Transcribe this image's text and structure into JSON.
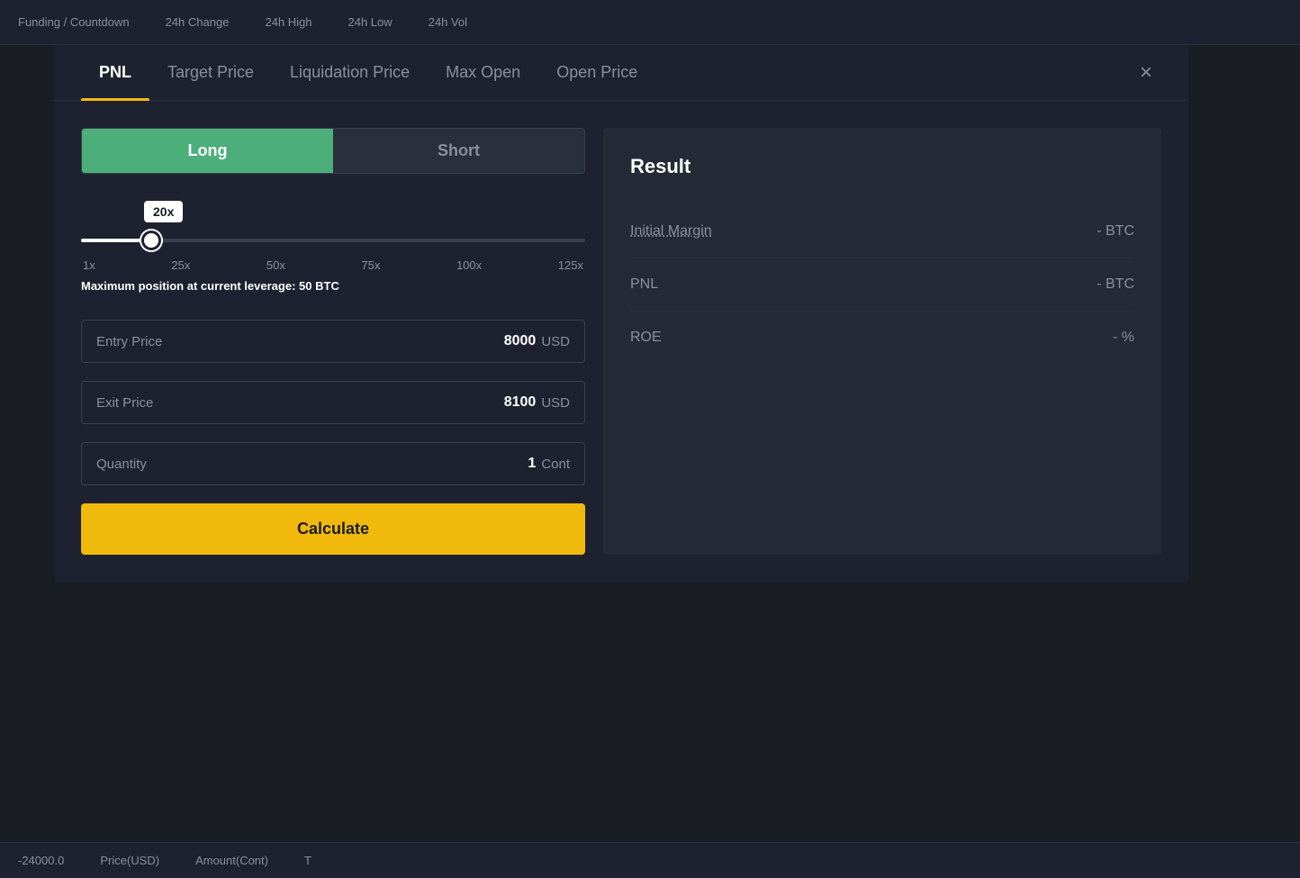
{
  "topbar": {
    "items": [
      "Funding / Countdown",
      "24h Change",
      "24h High",
      "24h Low",
      "24h Vol"
    ]
  },
  "tabs": {
    "items": [
      "PNL",
      "Target Price",
      "Liquidation Price",
      "Max Open",
      "Open Price"
    ],
    "active": 0,
    "close_label": "×"
  },
  "toggle": {
    "long_label": "Long",
    "short_label": "Short",
    "active": "long"
  },
  "leverage": {
    "badge": "20x",
    "labels": [
      "1x",
      "25x",
      "50x",
      "75x",
      "100x",
      "125x"
    ],
    "max_position_prefix": "Maximum position at current leverage: ",
    "max_position_value": "50",
    "max_position_unit": "BTC"
  },
  "inputs": {
    "entry_price": {
      "label": "Entry Price",
      "value": "8000",
      "unit": "USD"
    },
    "exit_price": {
      "label": "Exit Price",
      "value": "8100",
      "unit": "USD"
    },
    "quantity": {
      "label": "Quantity",
      "value": "1",
      "unit": "Cont"
    }
  },
  "calculate_btn": "Calculate",
  "result": {
    "title": "Result",
    "rows": [
      {
        "label": "Initial Margin",
        "value": "- BTC",
        "underline": true
      },
      {
        "label": "PNL",
        "value": "- BTC",
        "underline": false
      },
      {
        "label": "ROE",
        "value": "- %",
        "underline": false
      }
    ]
  },
  "bottombar": {
    "items": [
      "-24000.0",
      "Price(USD)",
      "Amount(Cont)",
      "T"
    ]
  }
}
